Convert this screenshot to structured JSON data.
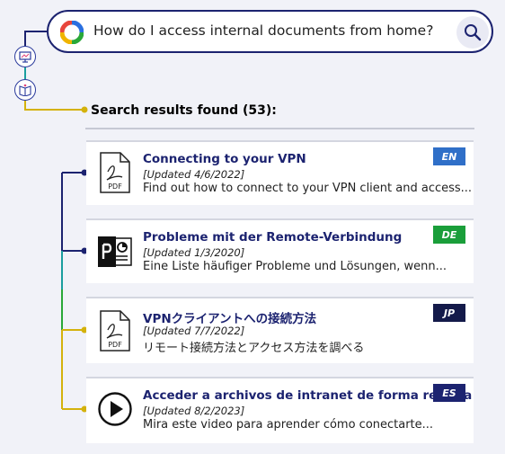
{
  "search": {
    "query": "How do I access internal documents from home?"
  },
  "side_icons": [
    "presentation-icon",
    "book-icon"
  ],
  "results": {
    "heading": "Search results found (53):",
    "items": [
      {
        "title": "Connecting to your VPN",
        "updated": "[Updated 4/6/2022]",
        "description": "Find out how to connect to your VPN client and access...",
        "language": "EN",
        "language_color": "#2f6fc8",
        "icon": "pdf-icon",
        "icon_label": "PDF"
      },
      {
        "title": "Probleme mit der Remote-Verbindung",
        "updated": "[Updated 1/3/2020]",
        "description": "Eine Liste häufiger Probleme und Lösungen, wenn...",
        "language": "DE",
        "language_color": "#1a9e3a",
        "icon": "powerpoint-icon"
      },
      {
        "title": "VPNクライアントへの接続方法",
        "updated": "[Updated 7/7/2022]",
        "description": "リモート接続方法とアクセス方法を調べる",
        "language": "JP",
        "language_color": "#141a4a",
        "icon": "pdf-icon",
        "icon_label": "PDF"
      },
      {
        "title": "Acceder a archivos de intranet de forma remota",
        "updated": "[Updated 8/2/2023]",
        "description": "Mira este video para aprender cómo conectarte...",
        "language": "ES",
        "language_color": "#1c2370",
        "icon": "video-play-icon"
      }
    ]
  },
  "colors": {
    "navy": "#1c2370",
    "gold": "#d4b20c",
    "teal": "#1a9e9e",
    "green": "#2aa838",
    "background": "#f1f2f8"
  }
}
